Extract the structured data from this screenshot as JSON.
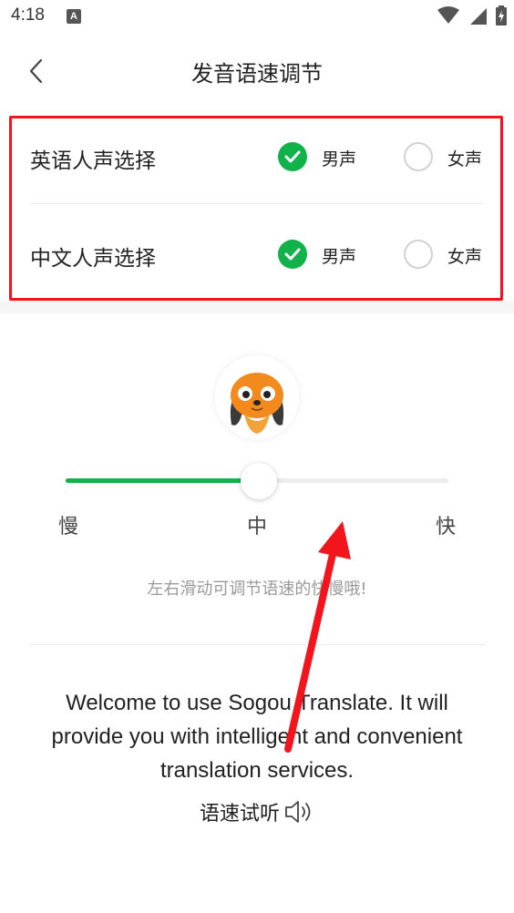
{
  "status_bar": {
    "time": "4:18",
    "notification_icon": "A"
  },
  "header": {
    "title": "发音语速调节",
    "back_icon": "chevron-left-icon"
  },
  "voice_selection": {
    "rows": [
      {
        "label": "英语人声选择",
        "options": [
          {
            "label": "男声",
            "checked": true
          },
          {
            "label": "女声",
            "checked": false
          }
        ]
      },
      {
        "label": "中文人声选择",
        "options": [
          {
            "label": "男声",
            "checked": true
          },
          {
            "label": "女声",
            "checked": false
          }
        ]
      }
    ],
    "highlight_color": "#f2161c"
  },
  "speed": {
    "labels": {
      "slow": "慢",
      "medium": "中",
      "fast": "快"
    },
    "value": 0.5,
    "accent_color": "#12b24b",
    "hint": "左右滑动可调节语速的快慢哦!"
  },
  "sample": {
    "text": "Welcome to use Sogou Translate. It will provide you with intelligent and convenient translation services.",
    "listen_label": "语速试听",
    "listen_icon": "speaker-icon"
  }
}
